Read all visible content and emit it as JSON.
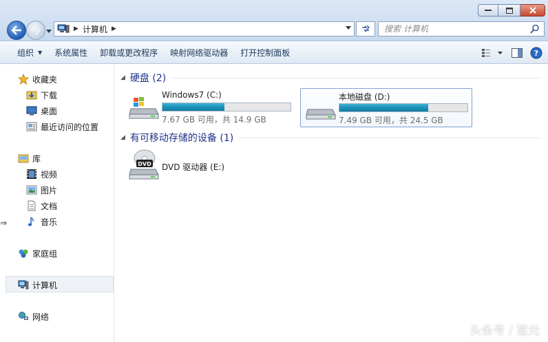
{
  "window": {
    "controls": {
      "minimize": "minimize",
      "maximize": "maximize",
      "close": "close"
    }
  },
  "address": {
    "segments": [
      "计算机"
    ]
  },
  "search": {
    "placeholder": "搜索 计算机"
  },
  "toolbar": {
    "organize": "组织",
    "system_properties": "系统属性",
    "uninstall": "卸载或更改程序",
    "map_drive": "映射网络驱动器",
    "control_panel": "打开控制面板"
  },
  "sidebar": {
    "favorites": {
      "label": "收藏夹",
      "items": [
        "下载",
        "桌面",
        "最近访问的位置"
      ]
    },
    "libraries": {
      "label": "库",
      "items": [
        "视频",
        "图片",
        "文档",
        "音乐"
      ]
    },
    "homegroup": "家庭组",
    "computer": "计算机",
    "network": "网络"
  },
  "groups": {
    "hard_disks": {
      "title": "硬盘 (2)",
      "drives": [
        {
          "name": "Windows7 (C:)",
          "space": "7.67 GB 可用，共 14.9 GB",
          "used_fraction": 0.485
        },
        {
          "name": "本地磁盘 (D:)",
          "space": "7.49 GB 可用，共 24.5 GB",
          "used_fraction": 0.694
        }
      ]
    },
    "removable": {
      "title": "有可移动存储的设备 (1)",
      "devices": [
        {
          "name": "DVD 驱动器 (E:)",
          "icon_label": "DVD"
        }
      ]
    }
  },
  "watermark": "头条号 / 慧光",
  "colors": {
    "bar_fill": "#1a8fb6",
    "group_title": "#1e3287",
    "selection_border": "#7da2ce"
  }
}
